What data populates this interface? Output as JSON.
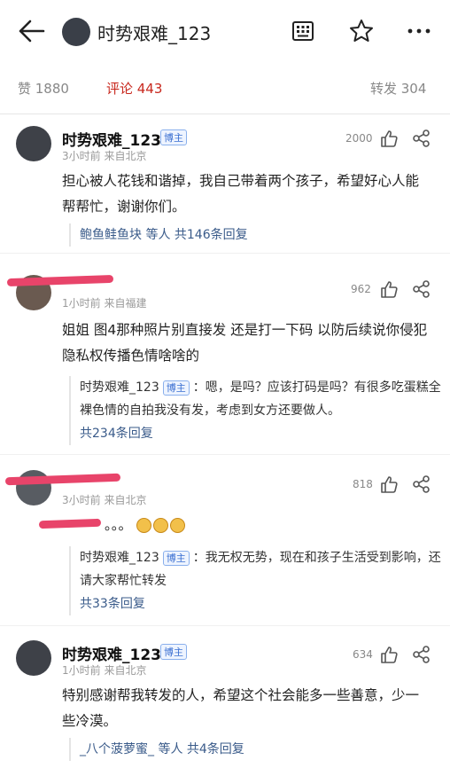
{
  "header": {
    "title": "时势艰难_123"
  },
  "stats": {
    "likes": "赞 1880",
    "comments": "评论 443",
    "reposts": "转发 304"
  },
  "comments": [
    {
      "name": "时势艰难_123",
      "badge": "博主",
      "meta": "3小时前  来自北京",
      "likes": "2000",
      "body": "担心被人花钱和谐掉，我自己带着两个孩子，希望好心人能帮帮忙，谢谢你们。",
      "reply_summary": "鲍鱼鲑鱼块 等人 共146条回复"
    },
    {
      "name": "",
      "meta": "1小时前  来自福建",
      "likes": "962",
      "body": "姐姐 图4那种照片别直接发 还是打一下码 以防后续说你侵犯隐私权传播色情啥啥的",
      "reply": {
        "name": "时势艰难_123",
        "badge": "博主",
        "text": "：嗯，是吗？应该打码是吗？有很多吃蛋糕全裸色情的自拍我没有发，考虑到女方还要做人。",
        "more": "共234条回复"
      }
    },
    {
      "name": "",
      "meta": "3小时前  来自北京",
      "likes": "818",
      "body": "。。。",
      "reply": {
        "name": "时势艰难_123",
        "badge": "博主",
        "text": "：我无权无势，现在和孩子生活受到影响，还请大家帮忙转发",
        "more": "共33条回复"
      }
    },
    {
      "name": "时势艰难_123",
      "badge": "博主",
      "meta": "1小时前  来自北京",
      "likes": "634",
      "body": "特别感谢帮我转发的人，希望这个社会能多一些善意，少一些冷漠。",
      "reply_summary": "_八个菠萝蜜_ 等人 共4条回复"
    }
  ]
}
